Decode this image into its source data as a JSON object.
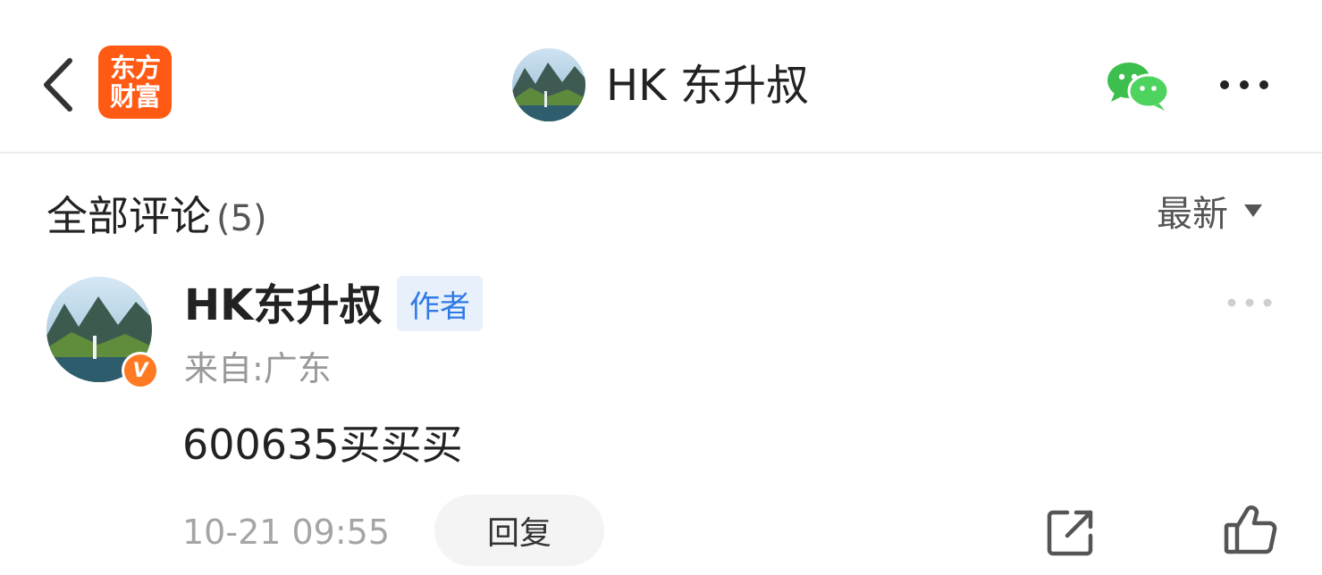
{
  "nav": {
    "logo_line1": "东方",
    "logo_line2": "财富",
    "title": "HK 东升叔",
    "icons": [
      "back-icon",
      "wechat-icon",
      "more-icon"
    ],
    "brand_color": "#ff5a14"
  },
  "comments": {
    "title": "全部评论",
    "count": "(5)",
    "sort_label": "最新"
  },
  "comment": {
    "author": "HK东升叔",
    "author_tag": "作者",
    "verified_badge": "V",
    "location": "来自:广东",
    "text": "600635买买买",
    "time": "10-21 09:55",
    "reply_label": "回复",
    "icons": [
      "share-icon",
      "like-icon",
      "more-icon"
    ],
    "tag_color": "#2f7be5"
  }
}
